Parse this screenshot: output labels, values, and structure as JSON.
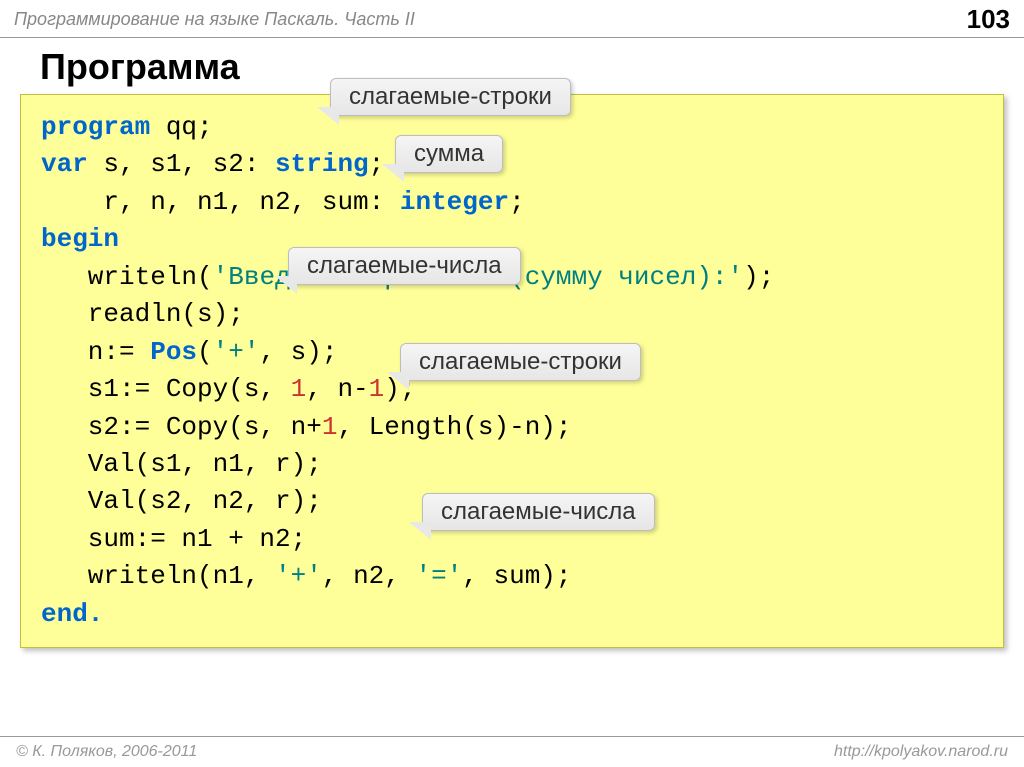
{
  "header": {
    "title": "Программирование на языке Паскаль. Часть II",
    "page_number": "103"
  },
  "section_title": "Программа",
  "code": {
    "l1a": "program",
    "l1b": " qq;",
    "l2a": "var",
    "l2b": " s, s1, s2: ",
    "l2c": "string",
    "l2d": ";",
    "l3a": "    r, n, n1, n2, sum: ",
    "l3b": "integer",
    "l3c": ";",
    "l4": "begin",
    "l5a": "   writeln(",
    "l5b": "'Введите выражение (сумму чисел):'",
    "l5c": ");",
    "l6": "   readln(s);",
    "l7a": "   n:= ",
    "l7b": "Pos",
    "l7c": "(",
    "l7d": "'+'",
    "l7e": ", s);",
    "l8a": "   s1:= Copy(s, ",
    "l8b": "1",
    "l8c": ", n-",
    "l8d": "1",
    "l8e": ");",
    "l9a": "   s2:= Copy(s, n+",
    "l9b": "1",
    "l9c": ", Length(s)-n);",
    "l10": "   Val(s1, n1, r);",
    "l11": "   Val(s2, n2, r);",
    "l12": "   sum:= n1 + n2;",
    "l13a": "   writeln(n1, ",
    "l13b": "'+'",
    "l13c": ", n2, ",
    "l13d": "'='",
    "l13e": ", sum);",
    "l14": "end."
  },
  "callouts": {
    "c1": "слагаемые-строки",
    "c2": "сумма",
    "c3": "слагаемые-числа",
    "c4": "слагаемые-строки",
    "c5": "слагаемые-числа"
  },
  "footer": {
    "copyright": "© К. Поляков, 2006-2011",
    "url": "http://kpolyakov.narod.ru"
  }
}
